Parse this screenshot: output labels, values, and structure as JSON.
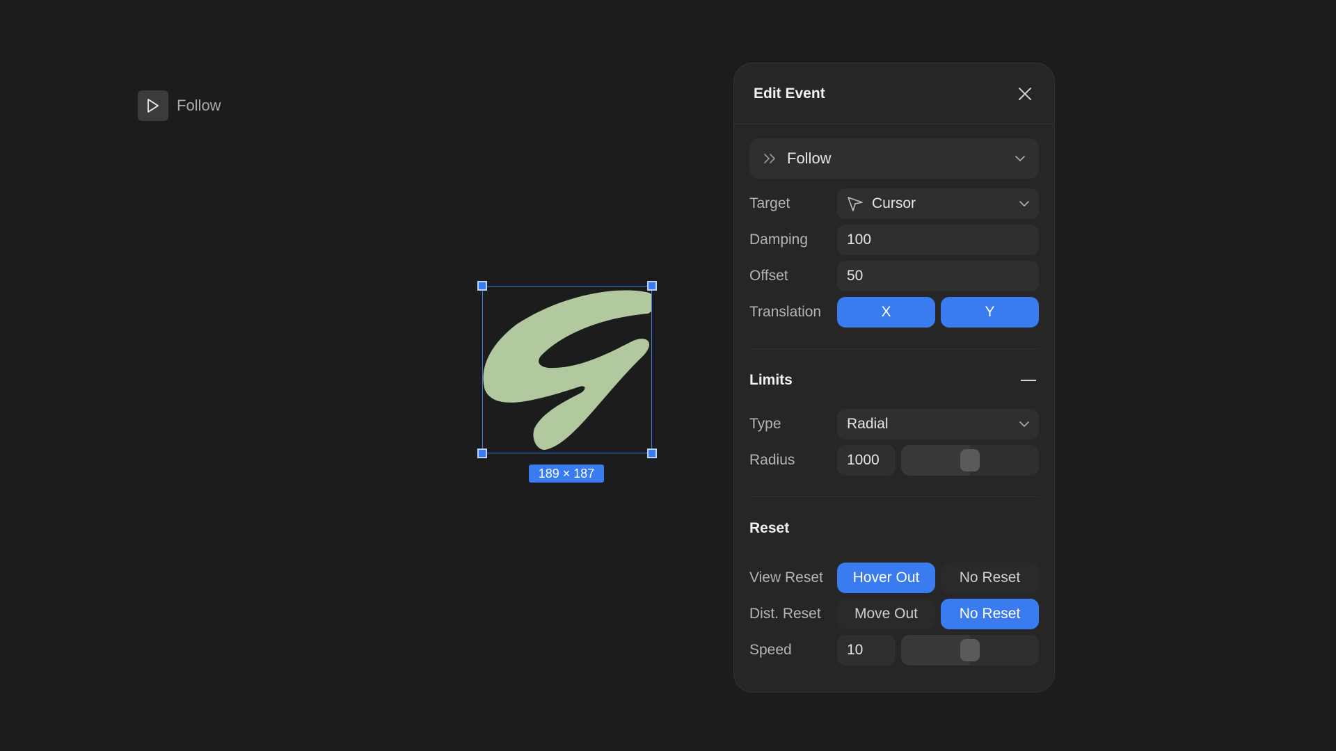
{
  "canvas": {
    "play_label": "Follow",
    "size_badge": "189 × 187",
    "shape_color": "#b2c9a0",
    "selection_color": "#3a7bf0"
  },
  "panel": {
    "title": "Edit Event",
    "event_type": "Follow",
    "target": {
      "label": "Target",
      "value": "Cursor"
    },
    "damping": {
      "label": "Damping",
      "value": "100"
    },
    "offset": {
      "label": "Offset",
      "value": "50"
    },
    "translation": {
      "label": "Translation",
      "x": "X",
      "y": "Y",
      "x_active": true,
      "y_active": true
    },
    "limits": {
      "title": "Limits",
      "type_label": "Type",
      "type_value": "Radial",
      "radius_label": "Radius",
      "radius_value": "1000",
      "radius_slider_fraction": 0.5
    },
    "reset": {
      "title": "Reset",
      "view_reset_label": "View Reset",
      "view_options": [
        "Hover Out",
        "No Reset"
      ],
      "view_active": "Hover Out",
      "dist_reset_label": "Dist. Reset",
      "dist_options": [
        "Move Out",
        "No Reset"
      ],
      "dist_active": "No Reset",
      "speed_label": "Speed",
      "speed_value": "10",
      "speed_slider_fraction": 0.5
    }
  },
  "colors": {
    "accent": "#3a7bf0",
    "panel_bg": "#262626",
    "page_bg": "#1c1c1c"
  }
}
